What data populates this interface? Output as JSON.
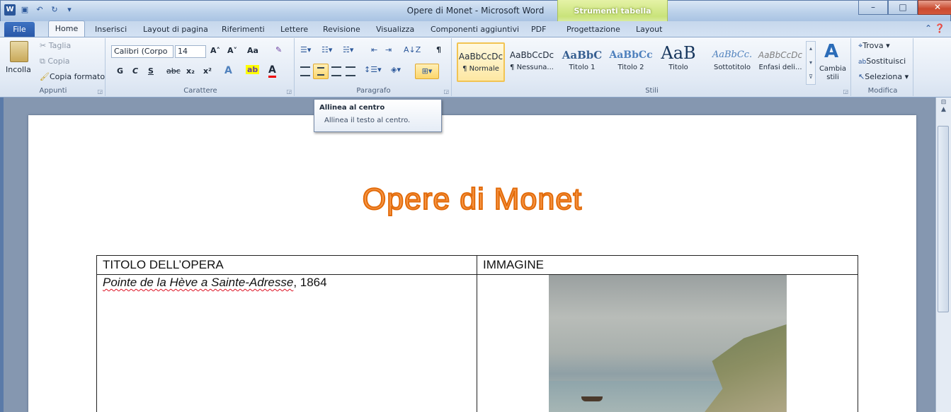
{
  "window": {
    "title": "Opere di Monet - Microsoft Word",
    "context_tab_group": "Strumenti tabella",
    "buttons": {
      "minimize": "–",
      "maximize": "□",
      "close": "✕"
    }
  },
  "qat": {
    "word_icon": "W",
    "save_icon": "💾",
    "undo_icon": "↶",
    "redo_icon": "↻",
    "customize_icon": "▾"
  },
  "tabs": {
    "file": "File",
    "items": [
      "Home",
      "Inserisci",
      "Layout di pagina",
      "Riferimenti",
      "Lettere",
      "Revisione",
      "Visualizza",
      "Componenti aggiuntivi",
      "PDF",
      "Progettazione",
      "Layout"
    ],
    "active": "Home"
  },
  "ribbon": {
    "clipboard": {
      "label": "Appunti",
      "paste": "Incolla",
      "cut": "Taglia",
      "copy": "Copia",
      "format_painter": "Copia formato"
    },
    "font": {
      "label": "Carattere",
      "font_name": "Calibri (Corpo",
      "font_size": "14",
      "grow": "A˄",
      "shrink": "A˅",
      "case": "Aa",
      "bold": "G",
      "italic": "C",
      "underline": "S",
      "strike": "abc",
      "subscript": "x₂",
      "superscript": "x²"
    },
    "paragraph": {
      "label": "Paragrafo",
      "pilcrow": "¶",
      "sort": "A↓Z"
    },
    "styles": {
      "label": "Stili",
      "items": [
        {
          "sample": "AaBbCcDc",
          "name": "¶ Normale"
        },
        {
          "sample": "AaBbCcDc",
          "name": "¶ Nessuna..."
        },
        {
          "sample": "AaBbC",
          "name": "Titolo 1"
        },
        {
          "sample": "AaBbCc",
          "name": "Titolo 2"
        },
        {
          "sample": "AaB",
          "name": "Titolo"
        },
        {
          "sample": "AaBbCc.",
          "name": "Sottotitolo"
        },
        {
          "sample": "AaBbCcDc",
          "name": "Enfasi deli..."
        }
      ],
      "change_styles": "Cambia stili"
    },
    "editing": {
      "label": "Modifica",
      "find": "Trova",
      "replace": "Sostituisci",
      "select": "Seleziona"
    }
  },
  "tooltip": {
    "title": "Allinea al centro",
    "description": "Allinea il testo al centro."
  },
  "document": {
    "heading": "Opere di Monet",
    "table": {
      "headers": [
        "TITOLO DELL’OPERA",
        "IMMAGINE"
      ],
      "rows": [
        {
          "title_italic": "Pointe de la Hève a Sainte-Adresse",
          "year": ", 1864"
        }
      ]
    }
  },
  "colors": {
    "heading_fill": "#f79646",
    "heading_outline": "#e26b0a",
    "context_tab_green": "#c9e37a",
    "file_tab_blue": "#2a58a8"
  }
}
